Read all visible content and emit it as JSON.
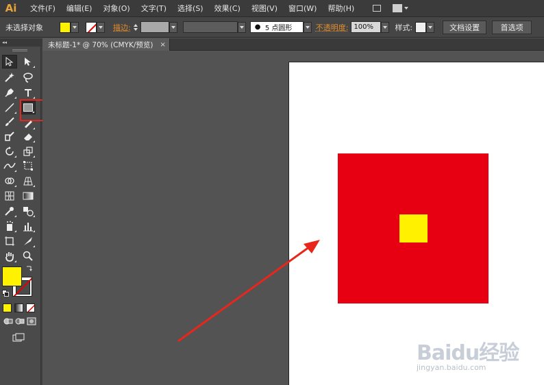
{
  "app": {
    "logo": "Ai"
  },
  "menu": [
    "文件(F)",
    "编辑(E)",
    "对象(O)",
    "文字(T)",
    "选择(S)",
    "效果(C)",
    "视图(V)",
    "窗口(W)",
    "帮助(H)"
  ],
  "control_bar": {
    "selection_status": "未选择对象",
    "stroke_label": "描边:",
    "brush_value": "5 点圆形",
    "opacity_label": "不透明度:",
    "opacity_value": "100%",
    "style_label": "样式:",
    "doc_setup_button": "文档设置",
    "preferences_button": "首选项"
  },
  "panel_collapse": "◂◂",
  "document_tab": {
    "title": "未标题-1* @ 70% (CMYK/预览)",
    "close": "×"
  },
  "artwork": {
    "outer_color": "#e60012",
    "inner_color": "#fff100",
    "artboard_color": "#ffffff"
  },
  "annotation": {
    "arrow_color": "#e8261b",
    "highlight_color": "#e8261b"
  },
  "tool_colors": {
    "fill": "#fff200",
    "stroke": "none"
  },
  "watermark": {
    "main": "Baidu经验",
    "sub": "jingyan.baidu.com"
  }
}
